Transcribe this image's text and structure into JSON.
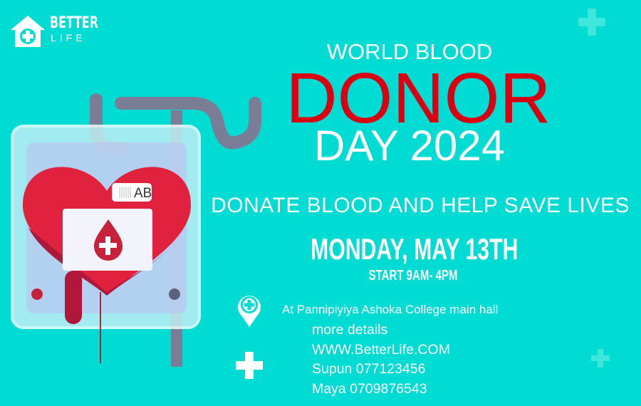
{
  "brand": {
    "name": "BETTER",
    "sub": "LIFE",
    "icon": "house-plus-icon"
  },
  "headline": {
    "line1": "WORLD BLOOD",
    "line2": "DONOR",
    "line3": "DAY 2024"
  },
  "tagline": "DONATE BLOOD AND HELP SAVE LIVES",
  "date": "MONDAY, MAY 13TH",
  "time": "START 9AM- 4PM",
  "location": {
    "icon": "location-pin-plus-icon",
    "text": "At Pannipiyiya Ashoka College main hall"
  },
  "details": {
    "icon": "plus-icon",
    "heading": "more details",
    "website": "WWW.BetterLife.COM",
    "contact1": "Supun 077123456",
    "contact2": "Maya 0709876543"
  },
  "illustration": {
    "blood_type": "AB"
  },
  "colors": {
    "background": "#00dcd4",
    "accent": "#d90012",
    "heart": "#e0223f"
  }
}
